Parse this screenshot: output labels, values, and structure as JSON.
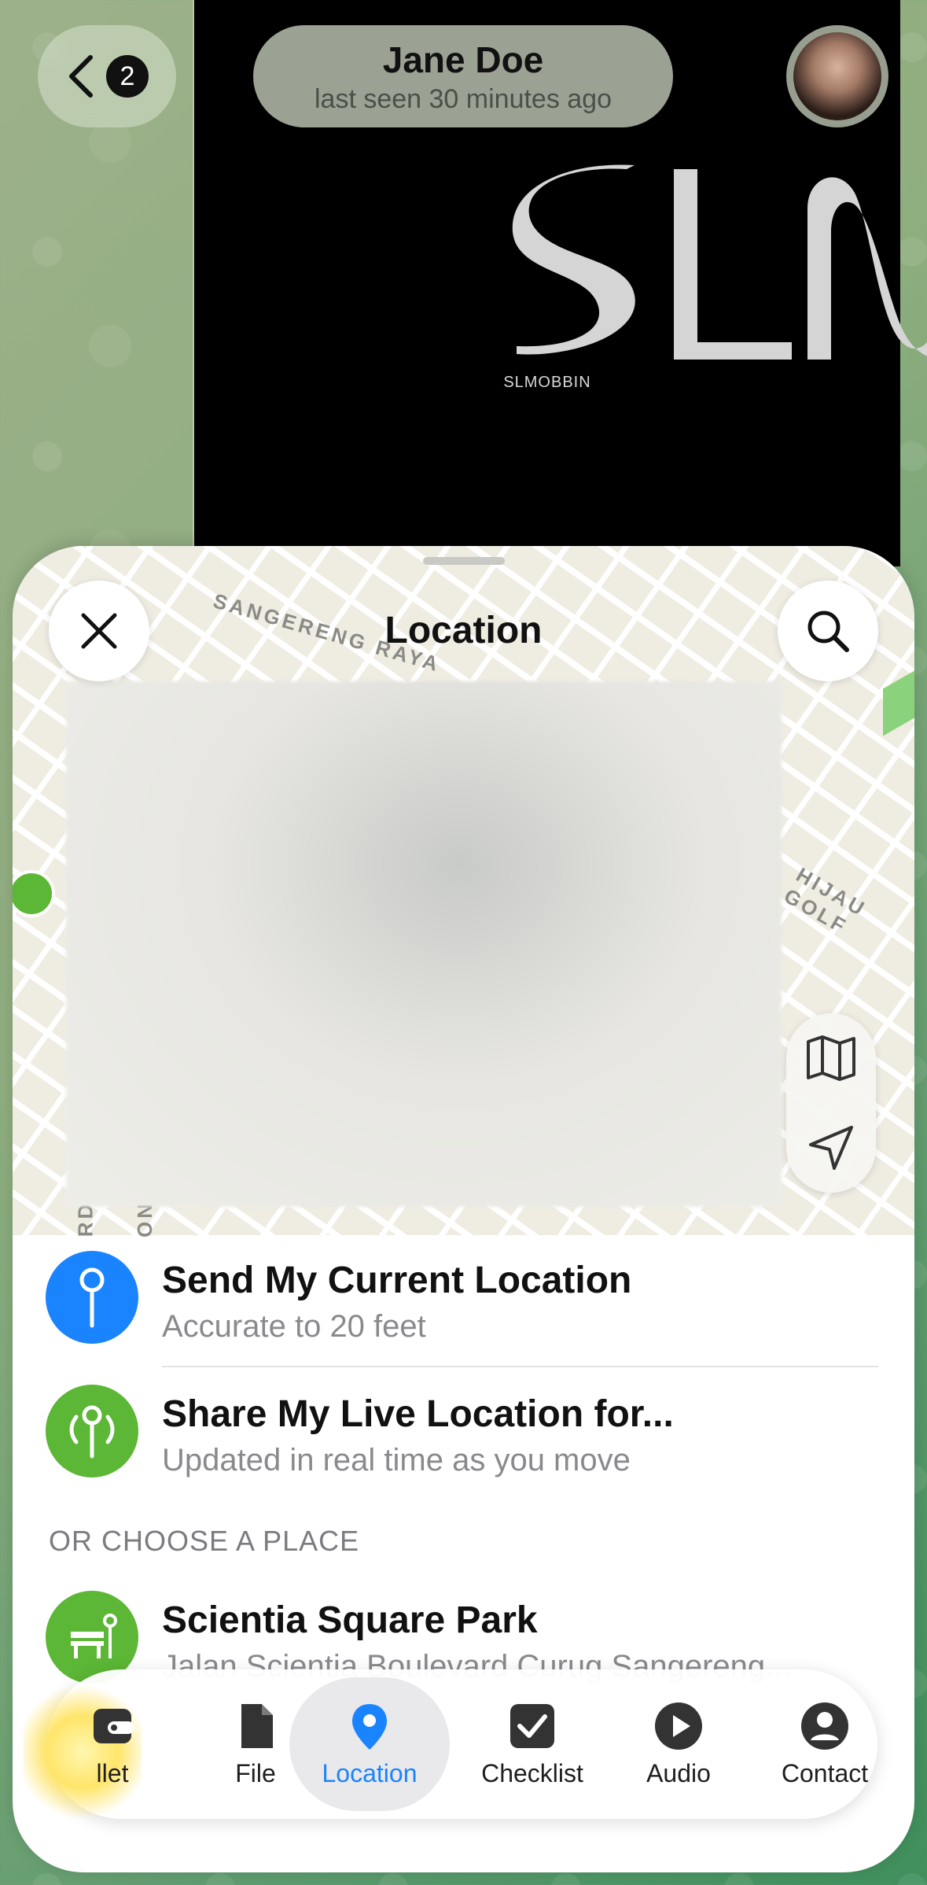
{
  "header": {
    "back_badge": "2",
    "contact_name": "Jane Doe",
    "contact_status": "last seen 30 minutes ago"
  },
  "chat_image": {
    "logo_text": "SLM",
    "caption": "SLMOBBIN"
  },
  "sheet": {
    "title": "Location",
    "map_labels": [
      "SANGERENG RAYA",
      "HIJAU GOLF",
      "RD",
      "ON"
    ]
  },
  "list": {
    "current": {
      "title": "Send My Current Location",
      "subtitle": "Accurate to 20 feet"
    },
    "live": {
      "title": "Share My Live Location for...",
      "subtitle": "Updated in real time as you move"
    },
    "section_header": "OR CHOOSE A PLACE",
    "places": [
      {
        "title": "Scientia Square Park",
        "subtitle": "Jalan Scientia Boulevard Curug Sangereng..."
      }
    ]
  },
  "tabbar": {
    "tabs": [
      {
        "label": "llet",
        "icon": "wallet-icon"
      },
      {
        "label": "File",
        "icon": "file-icon"
      },
      {
        "label": "Location",
        "icon": "location-pin-icon",
        "active": true
      },
      {
        "label": "Checklist",
        "icon": "checklist-icon"
      },
      {
        "label": "Audio",
        "icon": "audio-play-icon"
      },
      {
        "label": "Contact",
        "icon": "contact-icon"
      }
    ]
  },
  "colors": {
    "accent": "#1a84ff",
    "live_green": "#5bb735",
    "current_blue": "#1a84ff"
  }
}
